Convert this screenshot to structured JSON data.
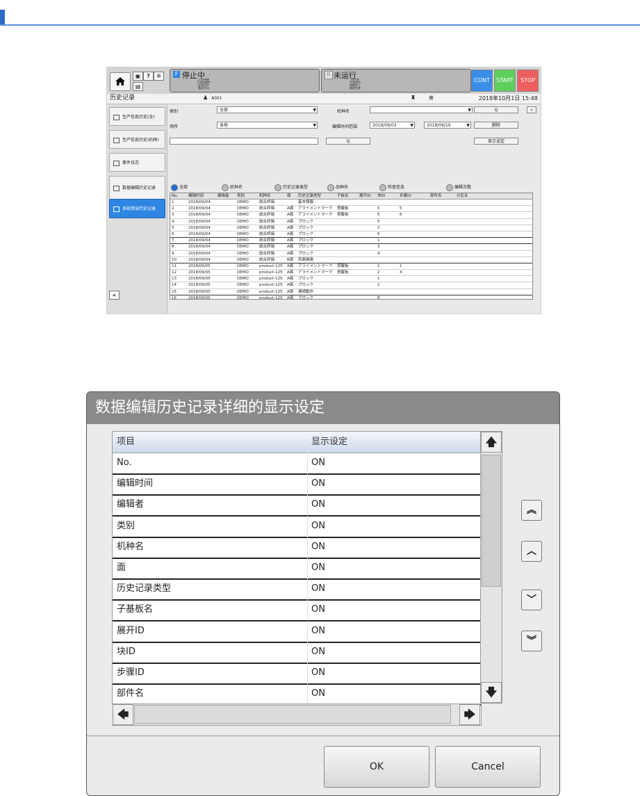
{
  "app": {
    "left_statuses": [
      "上流待機",
      "下流待機中",
      "生産途中",
      "搬送方向"
    ],
    "right_statuses": [
      "前生産",
      "生産途中",
      "待機完了",
      "最終生産"
    ],
    "status_stop_letter": "F",
    "status_stop": "停止中",
    "status_run_letter": "R",
    "status_run": "未运行",
    "ctl_cont": "CONT",
    "ctl_start": "START",
    "ctl_stop": "STOP",
    "page_title": "历史记录",
    "user": "A001",
    "datetime": "2018年10月1日 15:48",
    "nav": [
      "生产信息历史(全)",
      "生产信息历史(机种)",
      "事件日志",
      "数据编辑历史记录",
      "系统错误历史记录"
    ],
    "filters": {
      "kind_label": "类别",
      "kind_value": "全部",
      "model_label": "机种名",
      "model_value": "",
      "place_label": "场所",
      "place_value": "本地",
      "range_label": "编辑时间范围",
      "date_from": "2018/09/03",
      "date_to": "2018/09/19",
      "search_btn": "Q",
      "delete_btn": "删除",
      "display_btn": "显示设定"
    },
    "radios": [
      "全部",
      "机种名",
      "历史记录类型",
      "品种名",
      "检查信息",
      "编辑次数"
    ],
    "grid_headers": [
      "No.",
      "编辑时间",
      "编辑者",
      "类别",
      "机种名",
      "面",
      "历史记录类型",
      "子板名",
      "展开ID",
      "块ID",
      "步骤ID",
      "部件名",
      "分区名"
    ],
    "grid_rows": [
      [
        "1",
        "2018/09/04",
        "",
        "DEMO",
        "総合評価",
        "",
        "基本情報",
        "",
        "",
        "",
        "",
        "",
        ""
      ],
      [
        "2",
        "2018/09/04",
        "",
        "DEMO",
        "総合評価",
        "A面",
        "アライメントマーク",
        "搭載板",
        "",
        "5",
        "5",
        "",
        ""
      ],
      [
        "3",
        "2018/09/04",
        "",
        "DEMO",
        "総合評価",
        "A面",
        "アライメントマーク",
        "搭載板",
        "",
        "6",
        "6",
        "",
        ""
      ],
      [
        "4",
        "2018/09/04",
        "",
        "DEMO",
        "総合評価",
        "A面",
        "ブロック",
        "",
        "",
        "5",
        "",
        "",
        ""
      ],
      [
        "5",
        "2018/09/04",
        "",
        "DEMO",
        "総合評価",
        "A面",
        "ブロック",
        "",
        "",
        "2",
        "",
        "",
        ""
      ],
      [
        "6",
        "2018/09/04",
        "",
        "DEMO",
        "総合評価",
        "A面",
        "ブロック",
        "",
        "",
        "6",
        "",
        "",
        ""
      ],
      [
        "7",
        "2018/09/04",
        "",
        "DEMO",
        "総合評価",
        "A面",
        "ブロック",
        "",
        "",
        "1",
        "",
        "",
        ""
      ],
      [
        "8",
        "2018/09/04",
        "",
        "DEMO",
        "総合評価",
        "A面",
        "ブロック",
        "",
        "",
        "3",
        "",
        "",
        ""
      ],
      [
        "9",
        "2018/09/04",
        "",
        "DEMO",
        "総合評価",
        "A面",
        "ブロック",
        "",
        "",
        "4",
        "",
        "",
        ""
      ],
      [
        "10",
        "2018/09/04",
        "",
        "DEMO",
        "総合評価",
        "B面",
        "両面関連",
        "",
        "",
        "",
        "",
        "",
        ""
      ],
      [
        "11",
        "2018/09/05",
        "",
        "DEMO",
        "product-125",
        "A面",
        "アライメントマーク",
        "搭載板",
        "",
        "1",
        "1",
        "",
        ""
      ],
      [
        "12",
        "2018/09/05",
        "",
        "DEMO",
        "product-125",
        "A面",
        "アライメントマーク",
        "搭載板",
        "",
        "2",
        "4",
        "",
        ""
      ],
      [
        "13",
        "2018/09/05",
        "",
        "DEMO",
        "product-125",
        "A面",
        "ブロック",
        "",
        "",
        "1",
        "",
        "",
        ""
      ],
      [
        "14",
        "2018/09/05",
        "",
        "DEMO",
        "product-125",
        "A面",
        "ブロック",
        "",
        "",
        "2",
        "",
        "",
        ""
      ],
      [
        "15",
        "2018/09/05",
        "",
        "DEMO",
        "product-125",
        "A面",
        "連続動作",
        "",
        "",
        "",
        "",
        "",
        ""
      ],
      [
        "16",
        "2018/09/05",
        "",
        "DEMO",
        "product-125",
        "A面",
        "ブロック",
        "",
        "",
        "8",
        "",
        "",
        ""
      ],
      [
        "17",
        "2018/09/05",
        "",
        "DEMO",
        "product-125",
        "A面",
        "ブロック",
        "",
        "",
        "10",
        "",
        "",
        ""
      ],
      [
        "18",
        "2018/09/05",
        "",
        "DEMO",
        "product-125",
        "A面",
        "ブロック",
        "",
        "",
        "9",
        "",
        "",
        ""
      ]
    ]
  },
  "dialog": {
    "title": "数据编辑历史记录详细的显示设定",
    "col_item": "项目",
    "col_setting": "显示设定",
    "rows": [
      {
        "item": "No.",
        "value": "ON"
      },
      {
        "item": "编辑时间",
        "value": "ON"
      },
      {
        "item": "编辑者",
        "value": "ON"
      },
      {
        "item": "类别",
        "value": "ON"
      },
      {
        "item": "机种名",
        "value": "ON"
      },
      {
        "item": "面",
        "value": "ON"
      },
      {
        "item": "历史记录类型",
        "value": "ON"
      },
      {
        "item": "子基板名",
        "value": "ON"
      },
      {
        "item": "展开ID",
        "value": "ON"
      },
      {
        "item": "块ID",
        "value": "ON"
      },
      {
        "item": "步骤ID",
        "value": "ON"
      },
      {
        "item": "部件名",
        "value": "ON"
      }
    ],
    "ok": "OK",
    "cancel": "Cancel"
  }
}
